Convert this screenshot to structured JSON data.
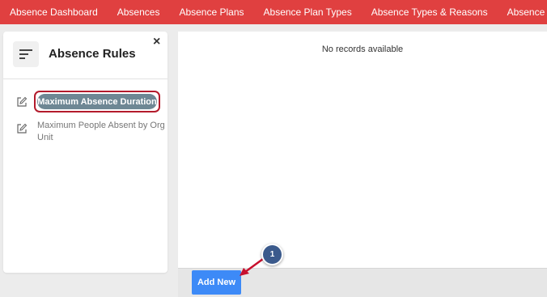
{
  "topnav": {
    "items": [
      "Absence Dashboard",
      "Absences",
      "Absence Plans",
      "Absence Plan Types",
      "Absence Types & Reasons",
      "Absence Rules"
    ],
    "color": "#e04040"
  },
  "sidebar": {
    "title": "Absence Rules",
    "close_label": "×",
    "rules": [
      {
        "label": "Maximum Absence Duration",
        "active": true
      },
      {
        "label": "Maximum People Absent by Org Unit",
        "active": false
      }
    ]
  },
  "main": {
    "empty_message": "No records available"
  },
  "footer": {
    "add_button_label": "Add New",
    "add_button_color": "#3d8af7"
  },
  "annotation": {
    "step_number": "1",
    "color": "#3b5a8c",
    "arrow_color": "#c8102e"
  },
  "icons": {
    "menu": "menu-lines-icon",
    "edit": "edit-icon",
    "close": "close-icon"
  }
}
